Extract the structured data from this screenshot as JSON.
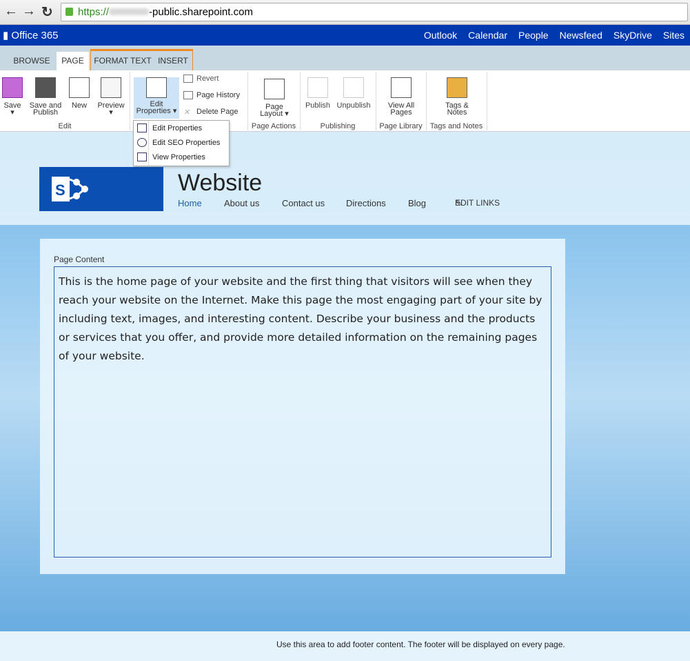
{
  "browser": {
    "url_scheme": "https://",
    "url_host": "-public.sharepoint.com"
  },
  "suite": {
    "brand": "Office 365",
    "links": [
      "Outlook",
      "Calendar",
      "People",
      "Newsfeed",
      "SkyDrive",
      "Sites"
    ],
    "color": "#0038b0"
  },
  "ribbon": {
    "tabs": [
      "BROWSE",
      "PAGE",
      "FORMAT TEXT",
      "INSERT"
    ],
    "active_tab": "PAGE",
    "buttons": {
      "save": "Save",
      "save_publish": "Save and Publish",
      "new": "New",
      "preview": "Preview",
      "edit_properties": "Edit Properties",
      "revert": "Revert",
      "page_history": "Page History",
      "delete_page": "Delete Page",
      "page_layout": "Page Layout",
      "publish": "Publish",
      "unpublish": "Unpublish",
      "view_all_pages": "View All Pages",
      "tags_notes": "Tags & Notes"
    },
    "groups": [
      "Edit",
      "Page Actions",
      "Publishing",
      "Page Library",
      "Tags and Notes"
    ],
    "dropdown": [
      "Edit Properties",
      "Edit SEO Properties",
      "View Properties"
    ]
  },
  "site": {
    "title": "Website",
    "nav": [
      "Home",
      "About us",
      "Contact us",
      "Directions",
      "Blog"
    ],
    "edit_links": "EDIT LINKS"
  },
  "content": {
    "label": "Page Content",
    "text": "This is the home page of your website and the first thing that visitors will see when they reach your website on the Internet. Make this page the most engaging part of your site by including text, images, and interesting content. Describe your business and the products or services that you offer, and provide more detailed information on the remaining pages of your website."
  },
  "footer": {
    "text": "Use this area to add footer content. The footer will be displayed on every page."
  }
}
